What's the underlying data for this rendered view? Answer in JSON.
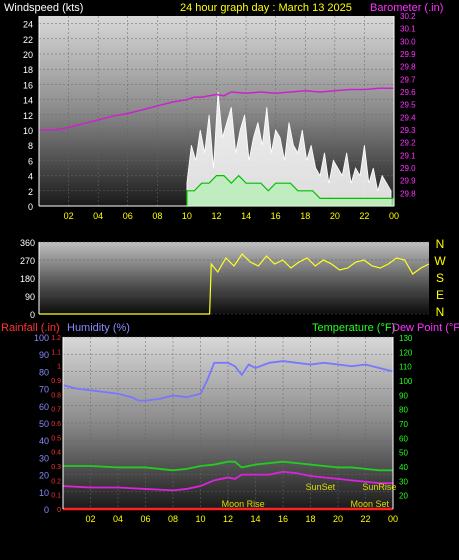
{
  "header": {
    "wind_label": "Windspeed (kts)",
    "title": "24 hour graph day : March 13 2025",
    "baro_label": "Barometer (.in)"
  },
  "wind_panel": {
    "title": "Windspeed (kts)",
    "baro_title": "Barometer (.in)"
  },
  "lower_header": {
    "rain_label": "Rainfall (.in)",
    "hum_label": "Humidity (%)",
    "temp_label": "Temperature (°F)",
    "dew_label": "Dew Point (°F)"
  },
  "compass_letters": [
    "N",
    "W",
    "S",
    "E",
    "N"
  ],
  "annotations": {
    "sunset": "SunSet",
    "sunrise": "SunRise",
    "moonrise": "Moon Rise",
    "moonset": "Moon Set"
  },
  "colors": {
    "wind": "#ffffff",
    "wind_avg": "#00c000",
    "wind_min": "#b8f0b8",
    "barometer": "#cc22cc",
    "direction": "#ffff22",
    "humidity": "#7777ff",
    "temperature": "#22cc22",
    "dewpoint": "#dd22dd",
    "rain": "#ff2222",
    "annotation": "#dddd00",
    "title": "#ffff00",
    "axis": "#ffff00"
  },
  "chart_data": [
    {
      "type": "line",
      "name": "windspeed-barometer",
      "title": "24 hour graph day : March 13 2025",
      "xlabel": "",
      "x_ticks": [
        "02",
        "04",
        "06",
        "08",
        "10",
        "12",
        "14",
        "16",
        "18",
        "20",
        "22",
        "00"
      ],
      "y_ticks": [
        0,
        2,
        4,
        6,
        8,
        10,
        12,
        14,
        16,
        18,
        20,
        22,
        24
      ],
      "ylabel": "Windspeed (kts)",
      "ylim": [
        0,
        25
      ],
      "y2label": "Barometer (.in)",
      "y2_ticks": [
        29.8,
        29.9,
        29.0,
        29.1,
        29.2,
        29.3,
        29.4,
        29.5,
        29.6,
        29.7,
        29.8,
        29.9,
        30.0,
        30.1,
        30.2
      ],
      "y2lim": [
        28.7,
        30.2
      ],
      "series": [
        {
          "name": "Barometer",
          "axis": "y2",
          "x": [
            0,
            1,
            2,
            3,
            4,
            5,
            6,
            7,
            8,
            9,
            10,
            10.5,
            11,
            12,
            12.5,
            13,
            14,
            15,
            16,
            17,
            18,
            19,
            20,
            21,
            22,
            23,
            24
          ],
          "values": [
            29.3,
            29.3,
            29.32,
            29.35,
            29.38,
            29.41,
            29.43,
            29.46,
            29.49,
            29.52,
            29.54,
            29.56,
            29.56,
            29.58,
            29.57,
            29.6,
            29.59,
            29.6,
            29.59,
            29.6,
            29.61,
            29.6,
            29.61,
            29.62,
            29.62,
            29.63,
            29.63
          ]
        },
        {
          "name": "Wind gust",
          "axis": "y",
          "x": [
            10,
            10.3,
            10.6,
            10.9,
            11.2,
            11.5,
            11.8,
            12.1,
            12.4,
            12.7,
            13,
            13.3,
            13.6,
            13.9,
            14.2,
            14.5,
            14.8,
            15.1,
            15.4,
            15.7,
            16,
            16.3,
            16.6,
            16.9,
            17.2,
            17.5,
            17.8,
            18.1,
            18.4,
            18.7,
            19,
            19.3,
            19.6,
            19.9,
            20.2,
            20.5,
            20.8,
            21.1,
            21.4,
            21.7,
            22,
            22.3,
            22.6,
            22.9,
            23.2,
            23.5,
            23.8
          ],
          "values": [
            3,
            8,
            6,
            10,
            7,
            12,
            5,
            15,
            9,
            11,
            13,
            7,
            10,
            12,
            6,
            9,
            11,
            8,
            13,
            7,
            10,
            9,
            6,
            11,
            8,
            7,
            10,
            6,
            8,
            5,
            4,
            7,
            3,
            6,
            5,
            4,
            7,
            3,
            5,
            4,
            8,
            3,
            5,
            2,
            4,
            3,
            2
          ]
        },
        {
          "name": "Wind average",
          "axis": "y",
          "x": [
            10,
            10.5,
            11,
            11.5,
            12,
            12.5,
            13,
            13.5,
            14,
            14.5,
            15,
            15.5,
            16,
            16.5,
            17,
            17.5,
            18,
            18.5,
            19,
            19.5,
            20,
            20.5,
            21,
            21.5,
            22,
            22.5,
            23,
            23.5,
            24
          ],
          "values": [
            2,
            2,
            3,
            3,
            4,
            4,
            3,
            4,
            3,
            3,
            3,
            2,
            3,
            3,
            3,
            2,
            2,
            2,
            1,
            1,
            1,
            1,
            1,
            1,
            1,
            1,
            1,
            1,
            1
          ]
        }
      ]
    },
    {
      "type": "line",
      "name": "wind-direction",
      "title": "",
      "y_ticks": [
        0,
        90,
        180,
        270,
        360
      ],
      "ylim": [
        0,
        360
      ],
      "series": [
        {
          "name": "Direction",
          "x": [
            0,
            5,
            10.5,
            10.6,
            11,
            11.5,
            12,
            12.5,
            13,
            13.5,
            14,
            14.5,
            15,
            15.5,
            16,
            16.5,
            17,
            17.5,
            18,
            18.5,
            19,
            19.5,
            20,
            20.5,
            21,
            21.5,
            22,
            22.5,
            23,
            23.5,
            24
          ],
          "values": [
            0,
            0,
            0,
            250,
            210,
            280,
            240,
            300,
            260,
            240,
            290,
            250,
            270,
            230,
            260,
            280,
            240,
            270,
            250,
            220,
            230,
            260,
            270,
            240,
            230,
            250,
            280,
            270,
            200,
            230,
            250
          ]
        }
      ]
    },
    {
      "type": "line",
      "name": "temperature-humidity",
      "title": "",
      "x_ticks": [
        "02",
        "04",
        "06",
        "08",
        "10",
        "12",
        "14",
        "16",
        "18",
        "20",
        "22",
        "00"
      ],
      "y_left_rain_ticks": [
        0,
        0.1,
        0.2,
        0.3,
        0.4,
        0.5,
        0.6,
        0.7,
        0.8,
        0.9,
        1,
        1.1,
        1.2
      ],
      "y_left_hum_ticks": [
        0,
        10,
        20,
        30,
        40,
        50,
        60,
        70,
        80,
        90,
        100
      ],
      "y_right_ticks": [
        20,
        30,
        40,
        50,
        60,
        70,
        80,
        90,
        100,
        110,
        120,
        130
      ],
      "humidity_lim": [
        0,
        100
      ],
      "temp_lim": [
        10,
        130
      ],
      "rain_lim": [
        0,
        1.2
      ],
      "series": [
        {
          "name": "Humidity",
          "axis": "humidity",
          "x": [
            0,
            1,
            2,
            3,
            4,
            5,
            5.5,
            6,
            7,
            8,
            9,
            10,
            10.5,
            11,
            12,
            12.5,
            13,
            13.5,
            14,
            15,
            16,
            17,
            18,
            19,
            20,
            21,
            22,
            23,
            24
          ],
          "values": [
            72,
            70,
            69,
            68,
            67,
            65,
            63,
            63,
            64,
            66,
            65,
            67,
            75,
            85,
            85,
            83,
            78,
            84,
            82,
            85,
            86,
            85,
            84,
            85,
            84,
            83,
            84,
            82,
            80
          ]
        },
        {
          "name": "Temperature",
          "axis": "temp",
          "x": [
            0,
            2,
            4,
            6,
            8,
            9,
            10,
            11,
            12,
            12.5,
            13,
            14,
            15,
            16,
            17,
            18,
            19,
            20,
            21,
            22,
            23,
            24
          ],
          "values": [
            40,
            40,
            39,
            39,
            37,
            38,
            40,
            41,
            43,
            43,
            39,
            41,
            42,
            43,
            42,
            41,
            40,
            39,
            39,
            38,
            37,
            37
          ]
        },
        {
          "name": "Dew Point",
          "axis": "temp",
          "x": [
            0,
            2,
            4,
            6,
            8,
            9,
            10,
            11,
            12,
            12.5,
            13,
            14,
            15,
            16,
            17,
            18,
            19,
            20,
            21,
            22,
            23,
            24
          ],
          "values": [
            26,
            25,
            25,
            24,
            23,
            24,
            26,
            30,
            32,
            31,
            34,
            34,
            34,
            36,
            35,
            33,
            32,
            31,
            30,
            29,
            28,
            28
          ]
        },
        {
          "name": "Rainfall",
          "axis": "rain",
          "x": [
            0,
            24
          ],
          "values": [
            0,
            0
          ]
        }
      ],
      "annotations": [
        {
          "text": "SunSet",
          "hour": 19.3
        },
        {
          "text": "SunRise",
          "hour": 7.3
        },
        {
          "text": "Moon Rise",
          "hour": 20.5
        },
        {
          "text": "Moon Set",
          "hour": 9.0
        }
      ]
    }
  ]
}
